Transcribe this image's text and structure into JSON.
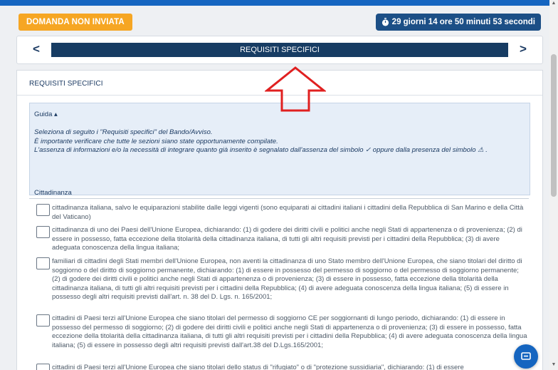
{
  "status_badge": "DOMANDA NON INVIATA",
  "countdown": "29 giorni 14 ore 50 minuti 53 secondi",
  "nav": {
    "title": "REQUISITI SPECIFICI",
    "prev": "<",
    "next": ">"
  },
  "section": {
    "title": "REQUISITI SPECIFICI"
  },
  "guida": {
    "toggle": "Guida ▴",
    "line1": "Seleziona di seguito i \"Requisiti specifici\" del Bando/Avviso.",
    "line2": "È importante verificare che tutte le sezioni siano state opportunamente compilate.",
    "line3": "L'assenza di informazioni e/o la necessità di integrare quanto già inserito è segnalato dall'assenza del simbolo ✓ oppure dalla presenza del simbolo ⚠ ."
  },
  "cittadinanza": {
    "label": "Cittadinanza",
    "options": [
      "cittadinanza italiana, salvo le equiparazioni stabilite dalle leggi vigenti (sono equiparati ai cittadini italiani i cittadini della Repubblica di San Marino e della Città del Vaticano)",
      "cittadinanza di uno dei Paesi dell'Unione Europea, dichiarando: (1) di godere dei diritti civili e politici anche negli Stati di appartenenza o di provenienza; (2) di essere in possesso, fatta eccezione della titolarità della cittadinanza italiana, di tutti gli altri requisiti previsti per i cittadini della Repubblica; (3) di avere adeguata conoscenza della lingua italiana;",
      "familiari di cittadini degli Stati membri dell'Unione Europea, non aventi la cittadinanza di uno Stato membro dell'Unione Europea, che siano titolari del diritto di soggiorno o del diritto di soggiorno permanente, dichiarando: (1) di essere in possesso del permesso di soggiorno o del permesso di soggiorno permanente; (2) di godere dei diritti civili e politici anche negli Stati di appartenenza o di provenienza; (3) di essere in possesso, fatta eccezione della titolarità della cittadinanza italiana, di tutti gli altri requisiti previsti per i cittadini della Repubblica; (4) di avere adeguata conoscenza della lingua italiana; (5) di essere in possesso degli altri requisiti previsti dall'art. n. 38 del D. Lgs. n. 165/2001;",
      "cittadini di Paesi terzi all'Unione Europea che siano titolari del permesso di soggiorno CE per soggiornanti di lungo periodo, dichiarando: (1) di essere in possesso del permesso di soggiorno; (2) di godere dei diritti civili e politici anche negli Stati di appartenenza o di provenienza; (3) di essere in possesso, fatta eccezione della titolarità della cittadinanza italiana, di tutti gli altri requisiti previsti per i cittadini della Repubblica; (4) di avere adeguata conoscenza della lingua italiana; (5) di essere in possesso degli altri requisiti previsti dall'art.38 del D.Lgs.165/2001;",
      "cittadini di Paesi terzi all'Unione Europea che siano titolari dello status di \"rifugiato\" o di \"protezione sussidiaria\", dichiarando: (1) di essere"
    ]
  },
  "colors": {
    "accent": "#1565c0",
    "nav_dark": "#173c63",
    "warning": "#f6a623",
    "arrow": "#e02020"
  },
  "icons": {
    "countdown": "stopwatch-icon",
    "chat": "chat-icon",
    "arrow": "up-arrow-annotation-icon"
  }
}
